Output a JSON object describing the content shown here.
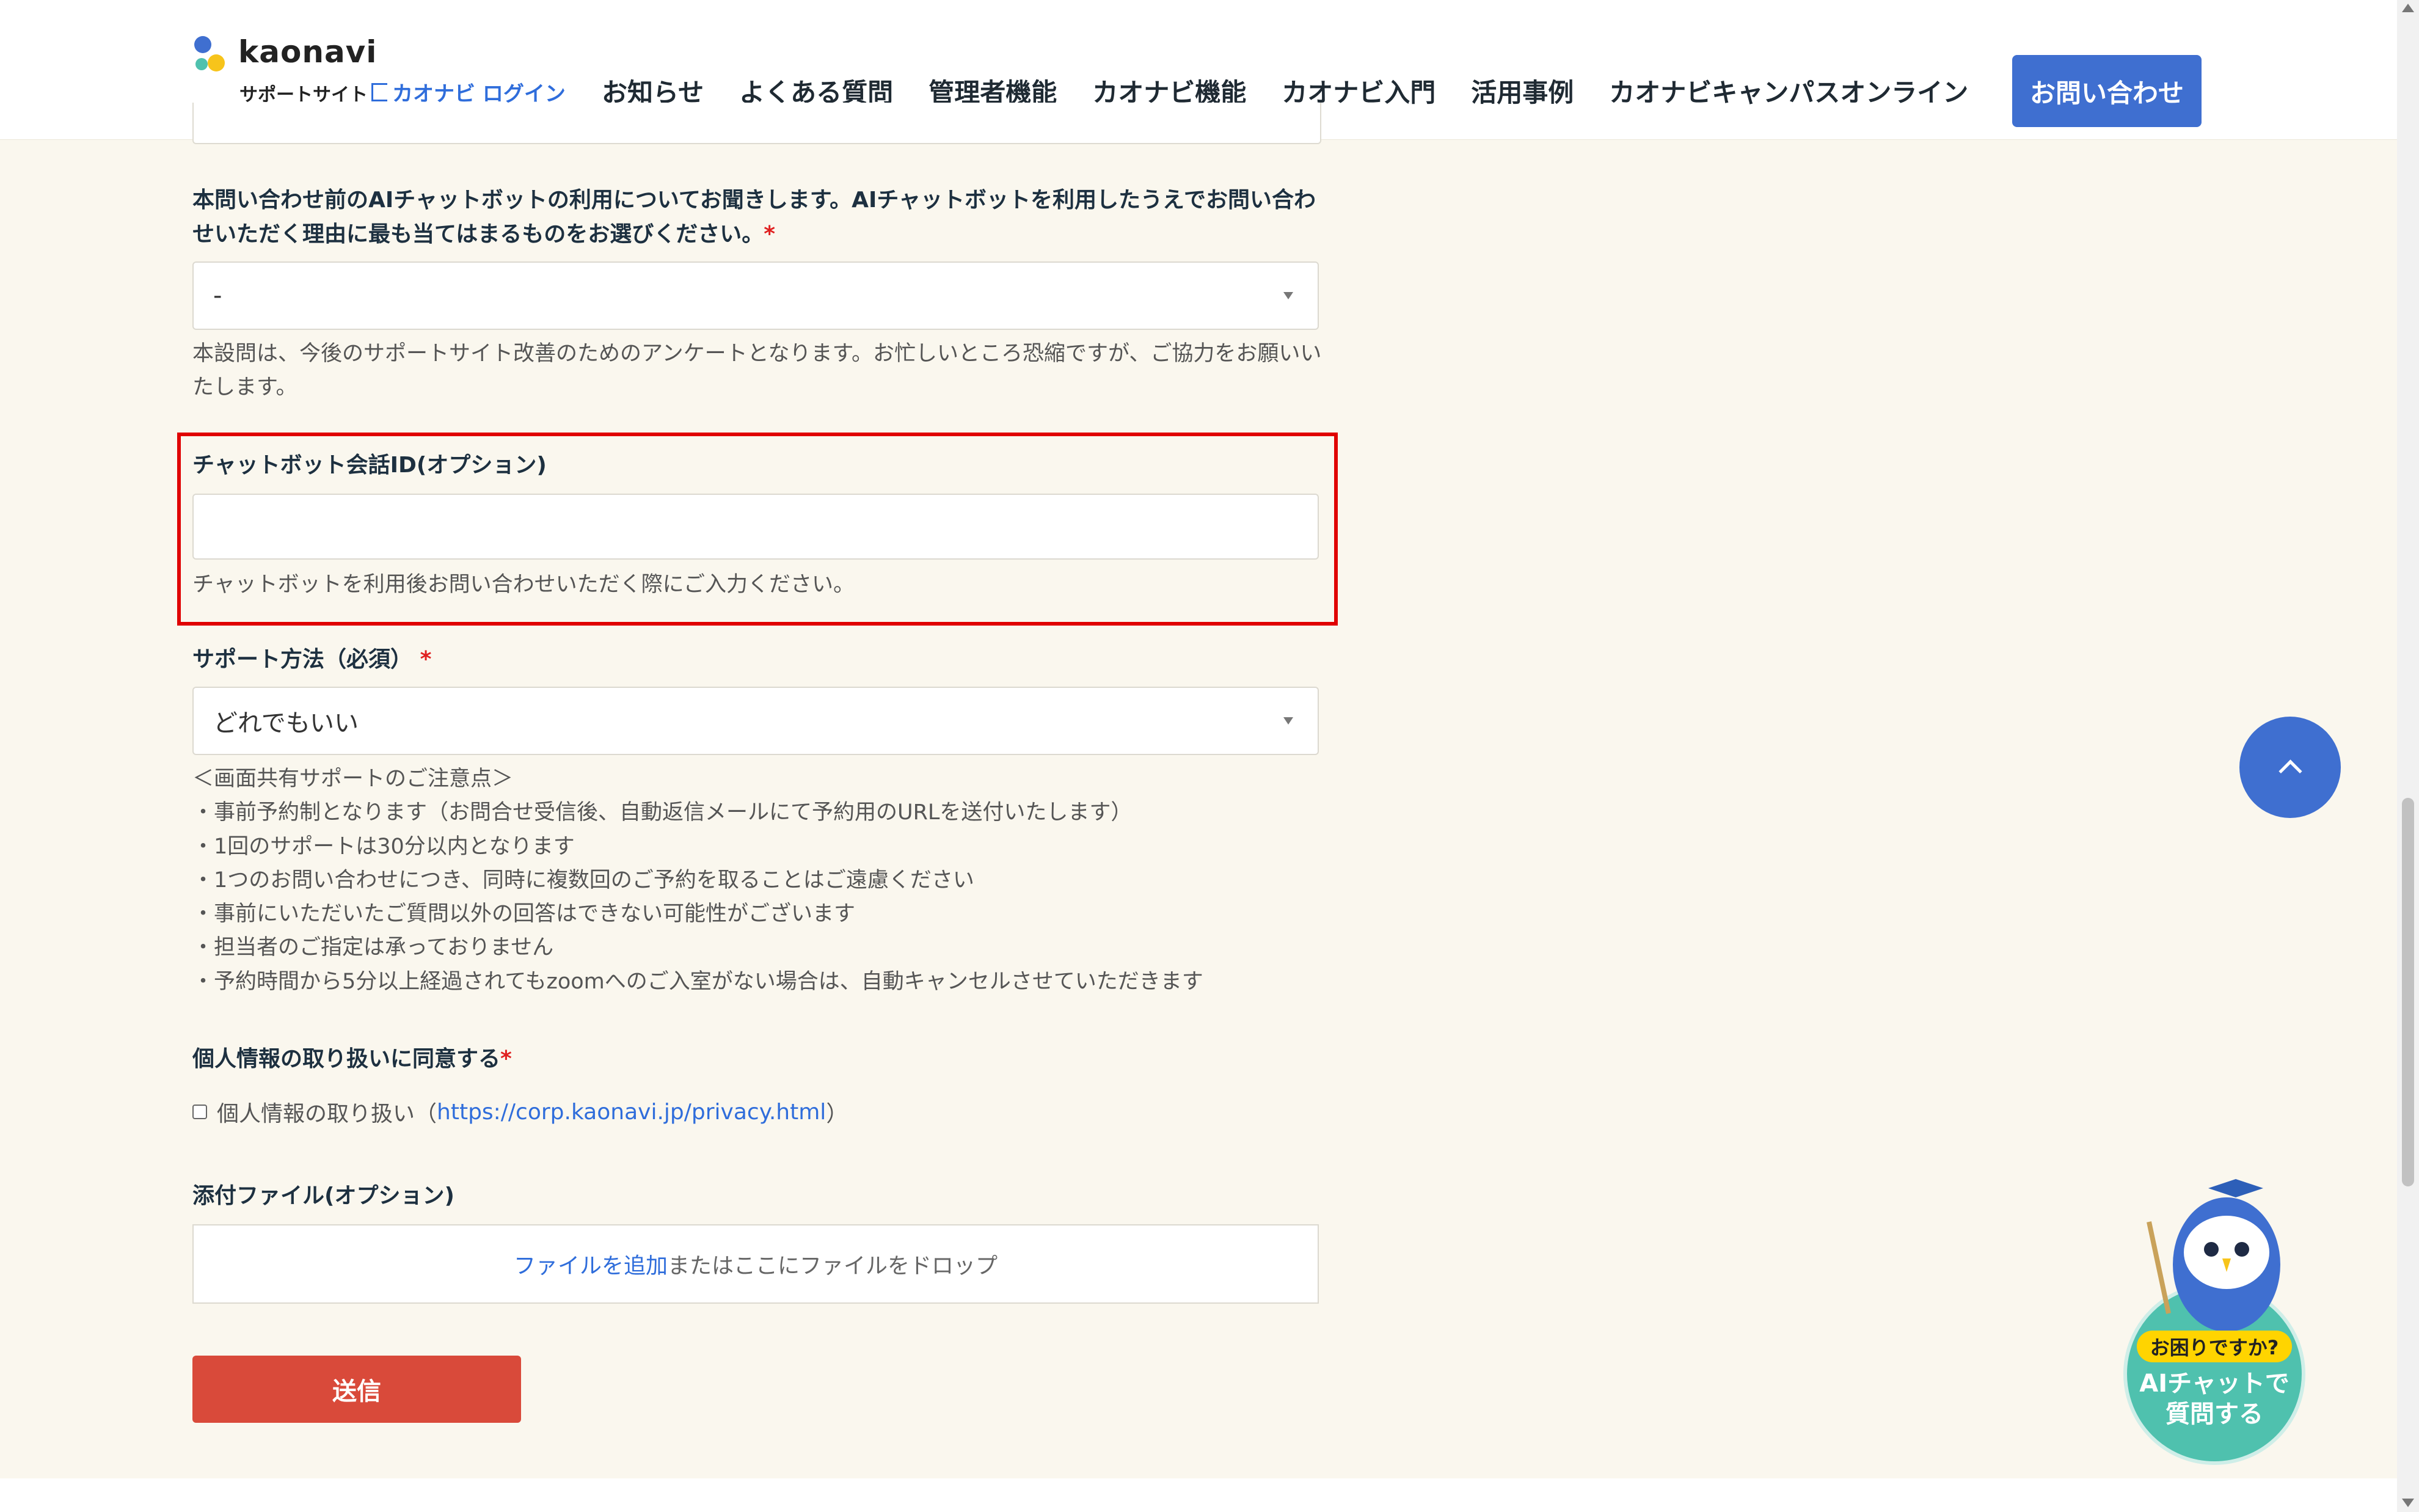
{
  "header": {
    "logo_text": "kaonavi",
    "support_site": "サポートサイト",
    "login_link": "カオナビ ログイン",
    "nav": [
      "お知らせ",
      "よくある質問",
      "管理者機能",
      "カオナビ機能",
      "カオナビ入門",
      "活用事例",
      "カオナビキャンパスオンライン"
    ],
    "contact_button": "お問い合わせ"
  },
  "form": {
    "ai_question": {
      "label": "本問い合わせ前のAIチャットボットの利用についてお聞きします。AIチャットボットを利用したうえでお問い合わせいただく理由に最も当てはまるものをお選びください。",
      "required_mark": "*",
      "value": "-",
      "help": "本設問は、今後のサポートサイト改善のためのアンケートとなります。お忙しいところ恐縮ですが、ご協力をお願いいたします。"
    },
    "chatbot_id": {
      "label": "チャットボット会話ID(オプション)",
      "value": "",
      "help": "チャットボットを利用後お問い合わせいただく際にご入力ください。"
    },
    "support_method": {
      "label": "サポート方法（必須）",
      "required_mark": "*",
      "value": "どれでもいい",
      "notes": [
        "＜画面共有サポートのご注意点＞",
        "・事前予約制となります（お問合せ受信後、自動返信メールにて予約用のURLを送付いたします）",
        "・1回のサポートは30分以内となります",
        "・1つのお問い合わせにつき、同時に複数回のご予約を取ることはご遠慮ください",
        "・事前にいただいたご質問以外の回答はできない可能性がございます",
        "・担当者のご指定は承っておりません",
        "・予約時間から5分以上経過されてもzoomへのご入室がない場合は、自動キャンセルさせていただきます"
      ]
    },
    "privacy": {
      "label": "個人情報の取り扱いに同意する",
      "required_mark": "*",
      "checkbox_text": "個人情報の取り扱い（",
      "link": "https://corp.kaonavi.jp/privacy.html",
      "close": "）",
      "checked": false
    },
    "attachment": {
      "label": "添付ファイル(オプション)",
      "add_link": "ファイルを追加",
      "drop_text": "またはここにファイルをドロップ"
    },
    "submit": "送信"
  },
  "chatbot_widget": {
    "badge": "お困りですか?",
    "line1": "AIチャットで",
    "line2": "質問する"
  },
  "colors": {
    "accent": "#3f6fd0",
    "submit": "#d94a3a",
    "highlight": "#e00000",
    "background": "#faf7ee"
  }
}
